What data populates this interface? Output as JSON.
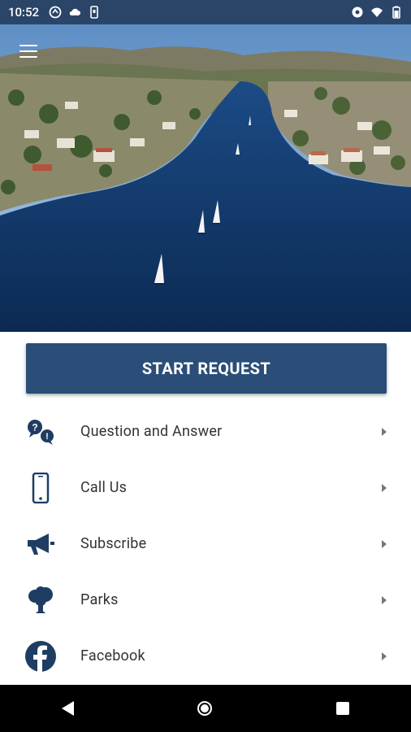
{
  "status_bar": {
    "time": "10:52",
    "icons_left": [
      "sync-icon",
      "cloud-icon",
      "phone-notification-icon"
    ],
    "icons_right": [
      "eye-icon",
      "wifi-icon",
      "battery-icon"
    ]
  },
  "hero": {
    "description_icon": "lake-image"
  },
  "start_request": {
    "label": "START REQUEST"
  },
  "menu": {
    "items": [
      {
        "label": "Question and Answer",
        "icon": "question-answer-icon"
      },
      {
        "label": "Call Us",
        "icon": "mobile-phone-icon"
      },
      {
        "label": "Subscribe",
        "icon": "megaphone-icon"
      },
      {
        "label": "Parks",
        "icon": "tree-icon"
      },
      {
        "label": "Facebook",
        "icon": "facebook-icon"
      }
    ]
  },
  "colors": {
    "primary": "#2b4e79",
    "status_bar": "#2b4569",
    "icon": "#1f3d63"
  }
}
